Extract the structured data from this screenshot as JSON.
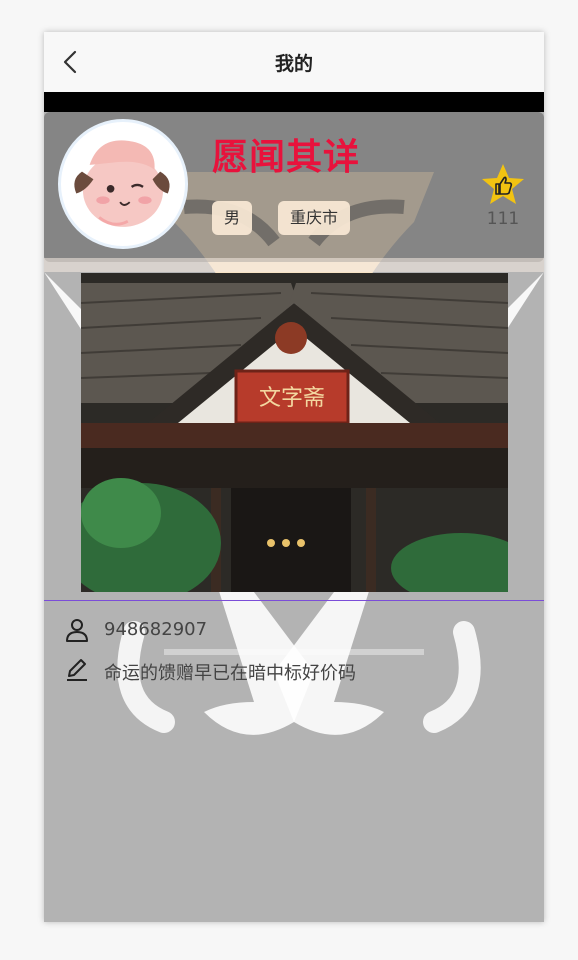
{
  "nav": {
    "title": "我的"
  },
  "profile": {
    "nickname": "愿闻其详",
    "gender": "男",
    "city": "重庆市",
    "likes": "111",
    "account": "948682907",
    "motto": "命运的馈赠早已在暗中标好价码"
  },
  "photo": {
    "sign_text": "文字斋"
  },
  "icons": {
    "back": "chevron-left-icon",
    "like": "thumbs-up-star-icon",
    "user": "user-icon",
    "edit": "pencil-icon"
  },
  "colors": {
    "nickname": "#e8123c",
    "like_star": "#f2c311",
    "divider": "#7b4dd8",
    "page_bg": "#b3b3b3"
  }
}
